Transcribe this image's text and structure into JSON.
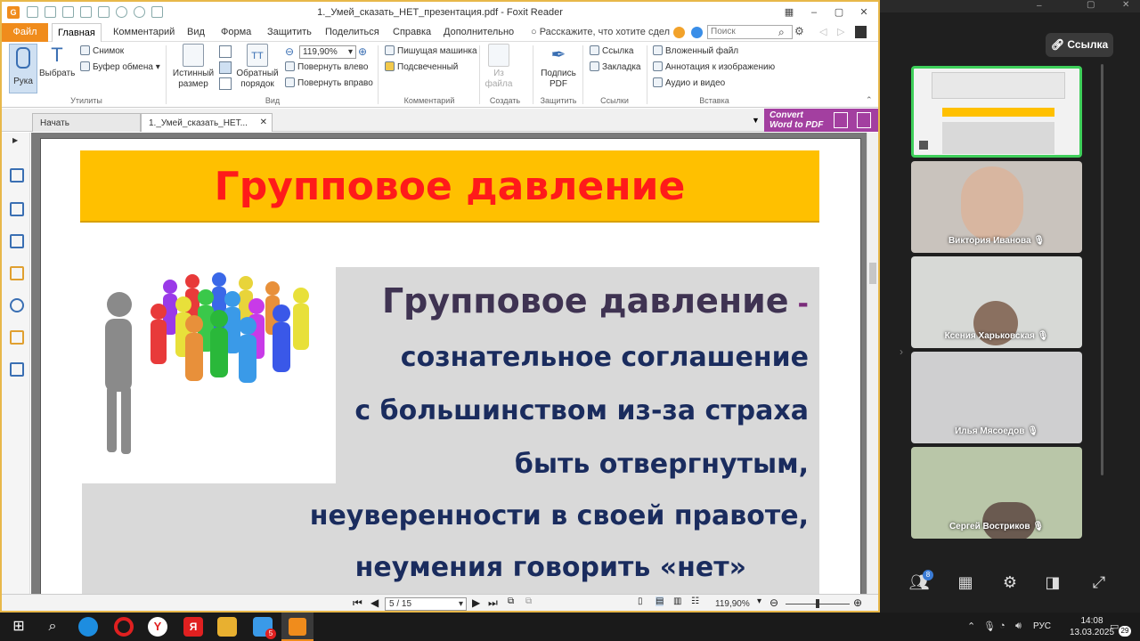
{
  "window": {
    "title": "1._Умей_сказать_НЕТ_презентация.pdf - Foxit Reader",
    "app_icon": "foxit-logo-icon"
  },
  "menu": {
    "file": "Файл",
    "tabs": [
      "Главная",
      "Комментарий",
      "Вид",
      "Форма",
      "Защитить",
      "Поделиться",
      "Справка",
      "Дополнительно"
    ],
    "tell_me": "Расскажите, что хотите сдел",
    "search_placeholder": "Поиск"
  },
  "ribbon": {
    "hand": "Рука",
    "select": "Выбрать",
    "snapshot": "Снимок",
    "clipboard": "Буфер обмена",
    "group_tools": "Утилиты",
    "actual_size_1": "Истинный",
    "actual_size_2": "размер",
    "reverse_1": "Обратный",
    "reverse_2": "порядок",
    "zoom_value": "119,90%",
    "rotate_left": "Повернуть влево",
    "rotate_right": "Повернуть вправо",
    "group_view": "Вид",
    "typewriter": "Пишущая машинка",
    "highlight": "Подсвеченный",
    "group_comment": "Комментарий",
    "from_file_1": "Из",
    "from_file_2": "файла",
    "group_create": "Создать",
    "sign_1": "Подпись",
    "sign_2": "PDF",
    "group_protect": "Защитить",
    "link": "Ссылка",
    "bookmark": "Закладка",
    "group_links": "Ссылки",
    "attached_file": "Вложенный файл",
    "image_annotation": "Аннотация к изображению",
    "audio_video": "Аудио и видео",
    "group_insert": "Вставка"
  },
  "doc_tabs": {
    "start": "Начать",
    "document": "1._Умей_сказать_НЕТ...",
    "convert_1": "Convert",
    "convert_2": "Word to PDF"
  },
  "slide": {
    "header": "Групповое давление",
    "title": "Групповое давление",
    "dash": "-",
    "lines": [
      "сознательное соглашение",
      "с большинством из-за страха",
      "быть  отвергнутым,",
      "неуверенности в своей правоте,",
      "неумения говорить «нет»"
    ]
  },
  "status": {
    "page": "5 / 15",
    "zoom": "119,90%"
  },
  "meeting": {
    "link_button": "Ссылка",
    "participants": [
      "Виктория Иванова",
      "Ксения Харьковская",
      "Илья Мясоедов",
      "Сергей Востриков"
    ],
    "participant_count": "8"
  },
  "taskbar": {
    "lang": "РУС",
    "time": "14:08",
    "date": "13.03.2025",
    "notifications": "29",
    "badge_5": "5"
  },
  "colors": {
    "foxit_orange": "#f08c1c",
    "slide_header_bg": "#ffc000",
    "slide_header_text": "#ff1a1a",
    "slide_text": "#1a2c5e",
    "active_speaker": "#3ecf5a"
  }
}
